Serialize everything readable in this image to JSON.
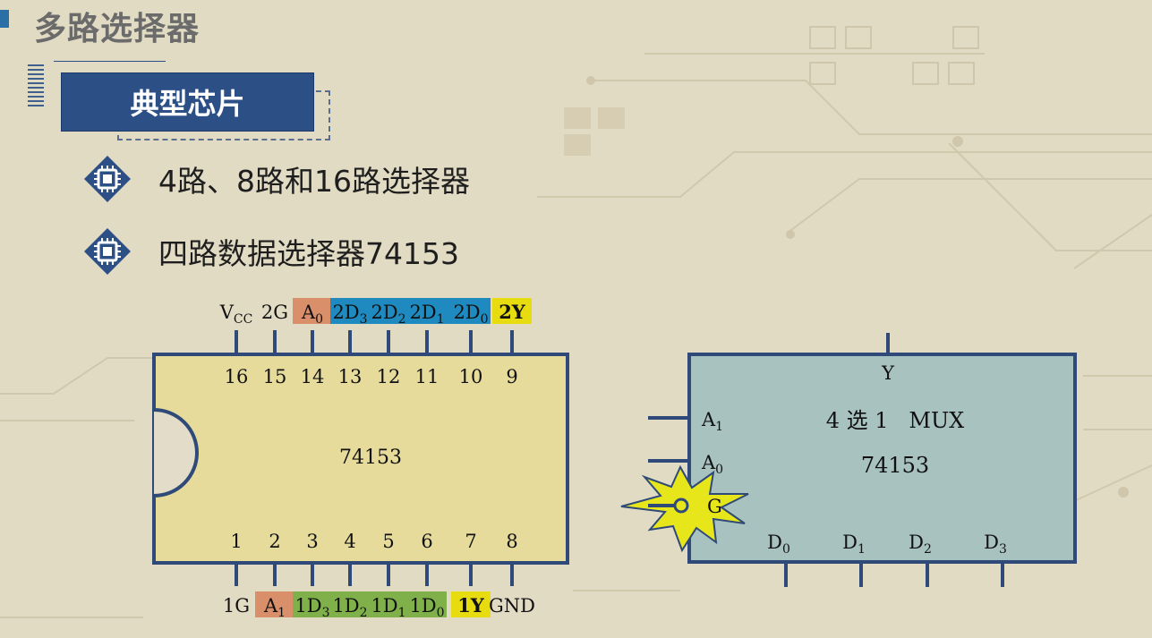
{
  "title": "多路选择器",
  "section": "典型芯片",
  "bullets": [
    "4路、8路和16路选择器",
    "四路数据选择器74153"
  ],
  "chip": {
    "label": "74153",
    "top_pins": [
      {
        "num": "16",
        "main": "V",
        "sub": "CC",
        "hl": "none"
      },
      {
        "num": "15",
        "main": "2G",
        "sub": "",
        "hl": "none"
      },
      {
        "num": "14",
        "main": "A",
        "sub": "0",
        "hl": "orange"
      },
      {
        "num": "13",
        "main": "2D",
        "sub": "3",
        "hl": "blue"
      },
      {
        "num": "12",
        "main": "2D",
        "sub": "2",
        "hl": "blue"
      },
      {
        "num": "11",
        "main": "2D",
        "sub": "1",
        "hl": "blue"
      },
      {
        "num": "10",
        "main": "2D",
        "sub": "0",
        "hl": "blue"
      },
      {
        "num": "9",
        "main": "2Y",
        "sub": "",
        "hl": "yellow"
      }
    ],
    "bottom_pins": [
      {
        "num": "1",
        "main": "1G",
        "sub": "",
        "hl": "none"
      },
      {
        "num": "2",
        "main": "A",
        "sub": "1",
        "hl": "orange"
      },
      {
        "num": "3",
        "main": "1D",
        "sub": "3",
        "hl": "green"
      },
      {
        "num": "4",
        "main": "1D",
        "sub": "2",
        "hl": "green"
      },
      {
        "num": "5",
        "main": "1D",
        "sub": "1",
        "hl": "green"
      },
      {
        "num": "6",
        "main": "1D",
        "sub": "0",
        "hl": "green"
      },
      {
        "num": "7",
        "main": "1Y",
        "sub": "",
        "hl": "yellow"
      },
      {
        "num": "8",
        "main": "GND",
        "sub": "",
        "hl": "none"
      }
    ]
  },
  "mux": {
    "output": "Y",
    "a1": {
      "main": "A",
      "sub": "1"
    },
    "a0": {
      "main": "A",
      "sub": "0"
    },
    "g": "G",
    "line1": "4 选 1   MUX",
    "line2": "74153",
    "inputs": [
      {
        "main": "D",
        "sub": "0"
      },
      {
        "main": "D",
        "sub": "1"
      },
      {
        "main": "D",
        "sub": "2"
      },
      {
        "main": "D",
        "sub": "3"
      }
    ]
  },
  "colors": {
    "accent": "#2c4f86",
    "chip_fill": "#e6db9a",
    "mux_fill": "#a8c2c0",
    "highlight_orange": "#d9906a",
    "highlight_blue": "#1f8ac0",
    "highlight_green": "#7fb04a",
    "highlight_yellow": "#e6dc10",
    "burst": "#e6e61a"
  }
}
